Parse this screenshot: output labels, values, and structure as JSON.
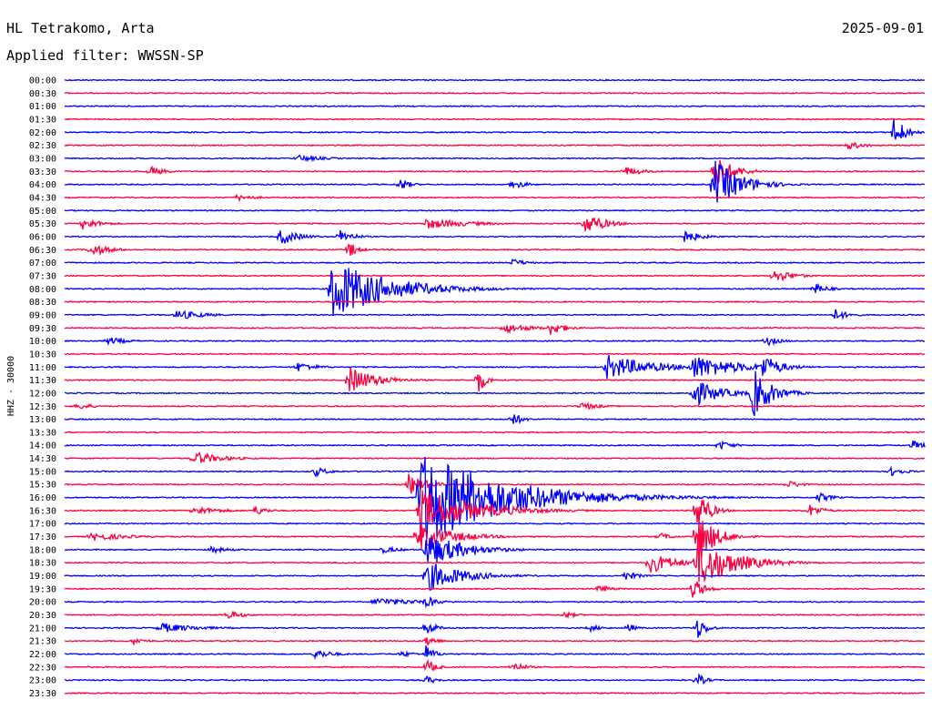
{
  "header": {
    "station": "HL Tetrakomo, Arta",
    "date": "2025-09-01",
    "filter": "Applied filter: WWSSN-SP"
  },
  "chart_data": {
    "type": "line",
    "ylabel": "HHZ - 30000",
    "row_times": [
      "00:00",
      "00:30",
      "01:00",
      "01:30",
      "02:00",
      "02:30",
      "03:00",
      "03:30",
      "04:00",
      "04:30",
      "05:00",
      "05:30",
      "06:00",
      "06:30",
      "07:00",
      "07:30",
      "08:00",
      "08:30",
      "09:00",
      "09:30",
      "10:00",
      "10:30",
      "11:00",
      "11:30",
      "12:00",
      "12:30",
      "13:00",
      "13:30",
      "14:00",
      "14:30",
      "15:00",
      "15:30",
      "16:00",
      "16:30",
      "17:00",
      "17:30",
      "18:00",
      "18:30",
      "19:00",
      "19:30",
      "20:00",
      "20:30",
      "21:00",
      "21:30",
      "22:00",
      "22:30",
      "23:00",
      "23:30"
    ],
    "colors": [
      "#0000ff",
      "#ff0040"
    ],
    "events": [
      {
        "row": 4,
        "t": 0.964,
        "amp": 20,
        "dur": 0.012
      },
      {
        "row": 5,
        "t": 0.91,
        "amp": 5,
        "dur": 0.02
      },
      {
        "row": 6,
        "t": 0.27,
        "amp": 4,
        "dur": 0.03
      },
      {
        "row": 7,
        "t": 0.1,
        "amp": 6,
        "dur": 0.015
      },
      {
        "row": 7,
        "t": 0.65,
        "amp": 6,
        "dur": 0.02
      },
      {
        "row": 7,
        "t": 0.755,
        "amp": 20,
        "dur": 0.02
      },
      {
        "row": 8,
        "t": 0.39,
        "amp": 8,
        "dur": 0.01
      },
      {
        "row": 8,
        "t": 0.52,
        "amp": 6,
        "dur": 0.015
      },
      {
        "row": 8,
        "t": 0.755,
        "amp": 28,
        "dur": 0.03
      },
      {
        "row": 9,
        "t": 0.2,
        "amp": 4,
        "dur": 0.02
      },
      {
        "row": 11,
        "t": 0.02,
        "amp": 7,
        "dur": 0.02
      },
      {
        "row": 11,
        "t": 0.42,
        "amp": 6,
        "dur": 0.05
      },
      {
        "row": 11,
        "t": 0.605,
        "amp": 14,
        "dur": 0.02
      },
      {
        "row": 12,
        "t": 0.25,
        "amp": 10,
        "dur": 0.02
      },
      {
        "row": 12,
        "t": 0.32,
        "amp": 8,
        "dur": 0.015
      },
      {
        "row": 12,
        "t": 0.72,
        "amp": 7,
        "dur": 0.02
      },
      {
        "row": 13,
        "t": 0.03,
        "amp": 8,
        "dur": 0.02
      },
      {
        "row": 13,
        "t": 0.33,
        "amp": 10,
        "dur": 0.01
      },
      {
        "row": 14,
        "t": 0.52,
        "amp": 5,
        "dur": 0.015
      },
      {
        "row": 15,
        "t": 0.825,
        "amp": 9,
        "dur": 0.02
      },
      {
        "row": 16,
        "t": 0.31,
        "amp": 36,
        "dur": 0.06
      },
      {
        "row": 16,
        "t": 0.35,
        "amp": 18,
        "dur": 0.06
      },
      {
        "row": 16,
        "t": 0.87,
        "amp": 7,
        "dur": 0.015
      },
      {
        "row": 18,
        "t": 0.13,
        "amp": 6,
        "dur": 0.03
      },
      {
        "row": 18,
        "t": 0.895,
        "amp": 7,
        "dur": 0.015
      },
      {
        "row": 19,
        "t": 0.51,
        "amp": 6,
        "dur": 0.03
      },
      {
        "row": 19,
        "t": 0.565,
        "amp": 9,
        "dur": 0.015
      },
      {
        "row": 20,
        "t": 0.05,
        "amp": 5,
        "dur": 0.02
      },
      {
        "row": 20,
        "t": 0.815,
        "amp": 6,
        "dur": 0.015
      },
      {
        "row": 22,
        "t": 0.27,
        "amp": 6,
        "dur": 0.02
      },
      {
        "row": 22,
        "t": 0.63,
        "amp": 14,
        "dur": 0.05
      },
      {
        "row": 22,
        "t": 0.73,
        "amp": 14,
        "dur": 0.05
      },
      {
        "row": 22,
        "t": 0.81,
        "amp": 16,
        "dur": 0.02
      },
      {
        "row": 23,
        "t": 0.33,
        "amp": 16,
        "dur": 0.03
      },
      {
        "row": 23,
        "t": 0.48,
        "amp": 18,
        "dur": 0.008
      },
      {
        "row": 24,
        "t": 0.73,
        "amp": 16,
        "dur": 0.03
      },
      {
        "row": 24,
        "t": 0.8,
        "amp": 30,
        "dur": 0.02
      },
      {
        "row": 25,
        "t": 0.015,
        "amp": 5,
        "dur": 0.015
      },
      {
        "row": 25,
        "t": 0.6,
        "amp": 5,
        "dur": 0.02
      },
      {
        "row": 26,
        "t": 0.52,
        "amp": 9,
        "dur": 0.01
      },
      {
        "row": 28,
        "t": 0.76,
        "amp": 6,
        "dur": 0.015
      },
      {
        "row": 28,
        "t": 0.985,
        "amp": 6,
        "dur": 0.015
      },
      {
        "row": 29,
        "t": 0.15,
        "amp": 8,
        "dur": 0.03
      },
      {
        "row": 30,
        "t": 0.29,
        "amp": 6,
        "dur": 0.015
      },
      {
        "row": 30,
        "t": 0.96,
        "amp": 6,
        "dur": 0.015
      },
      {
        "row": 31,
        "t": 0.4,
        "amp": 12,
        "dur": 0.02
      },
      {
        "row": 31,
        "t": 0.84,
        "amp": 5,
        "dur": 0.015
      },
      {
        "row": 32,
        "t": 0.413,
        "amp": 56,
        "dur": 0.09
      },
      {
        "row": 32,
        "t": 0.875,
        "amp": 6,
        "dur": 0.015
      },
      {
        "row": 33,
        "t": 0.15,
        "amp": 5,
        "dur": 0.03
      },
      {
        "row": 33,
        "t": 0.22,
        "amp": 6,
        "dur": 0.015
      },
      {
        "row": 33,
        "t": 0.413,
        "amp": 24,
        "dur": 0.06
      },
      {
        "row": 33,
        "t": 0.735,
        "amp": 28,
        "dur": 0.012
      },
      {
        "row": 33,
        "t": 0.865,
        "amp": 8,
        "dur": 0.015
      },
      {
        "row": 35,
        "t": 0.03,
        "amp": 5,
        "dur": 0.04
      },
      {
        "row": 35,
        "t": 0.41,
        "amp": 16,
        "dur": 0.04
      },
      {
        "row": 35,
        "t": 0.69,
        "amp": 5,
        "dur": 0.015
      },
      {
        "row": 35,
        "t": 0.735,
        "amp": 30,
        "dur": 0.02
      },
      {
        "row": 36,
        "t": 0.17,
        "amp": 4,
        "dur": 0.02
      },
      {
        "row": 36,
        "t": 0.37,
        "amp": 4,
        "dur": 0.02
      },
      {
        "row": 36,
        "t": 0.42,
        "amp": 20,
        "dur": 0.04
      },
      {
        "row": 37,
        "t": 0.68,
        "amp": 12,
        "dur": 0.03
      },
      {
        "row": 37,
        "t": 0.735,
        "amp": 30,
        "dur": 0.04
      },
      {
        "row": 38,
        "t": 0.42,
        "amp": 18,
        "dur": 0.04
      },
      {
        "row": 38,
        "t": 0.65,
        "amp": 6,
        "dur": 0.015
      },
      {
        "row": 39,
        "t": 0.62,
        "amp": 5,
        "dur": 0.015
      },
      {
        "row": 39,
        "t": 0.73,
        "amp": 14,
        "dur": 0.012
      },
      {
        "row": 40,
        "t": 0.36,
        "amp": 5,
        "dur": 0.05
      },
      {
        "row": 40,
        "t": 0.42,
        "amp": 8,
        "dur": 0.012
      },
      {
        "row": 41,
        "t": 0.19,
        "amp": 6,
        "dur": 0.015
      },
      {
        "row": 41,
        "t": 0.58,
        "amp": 4,
        "dur": 0.015
      },
      {
        "row": 42,
        "t": 0.11,
        "amp": 6,
        "dur": 0.04
      },
      {
        "row": 42,
        "t": 0.42,
        "amp": 10,
        "dur": 0.01
      },
      {
        "row": 42,
        "t": 0.61,
        "amp": 4,
        "dur": 0.015
      },
      {
        "row": 42,
        "t": 0.655,
        "amp": 6,
        "dur": 0.008
      },
      {
        "row": 42,
        "t": 0.735,
        "amp": 14,
        "dur": 0.01
      },
      {
        "row": 43,
        "t": 0.08,
        "amp": 4,
        "dur": 0.015
      },
      {
        "row": 43,
        "t": 0.42,
        "amp": 8,
        "dur": 0.01
      },
      {
        "row": 44,
        "t": 0.29,
        "amp": 6,
        "dur": 0.02
      },
      {
        "row": 44,
        "t": 0.39,
        "amp": 4,
        "dur": 0.015
      },
      {
        "row": 44,
        "t": 0.42,
        "amp": 10,
        "dur": 0.01
      },
      {
        "row": 45,
        "t": 0.52,
        "amp": 6,
        "dur": 0.015
      },
      {
        "row": 45,
        "t": 0.42,
        "amp": 10,
        "dur": 0.01
      },
      {
        "row": 46,
        "t": 0.42,
        "amp": 6,
        "dur": 0.01
      },
      {
        "row": 46,
        "t": 0.735,
        "amp": 8,
        "dur": 0.01
      }
    ]
  }
}
